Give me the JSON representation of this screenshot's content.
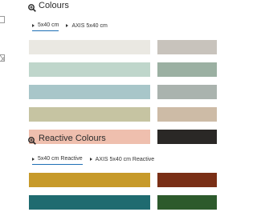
{
  "colours_section": {
    "title": "Colours",
    "tabs": [
      {
        "label": "5x40 cm",
        "active": true
      },
      {
        "label": "AXIS 5x40 cm",
        "active": false
      }
    ],
    "swatches": [
      {
        "color": "#eae8e2"
      },
      {
        "color": "#c8c3bc"
      },
      {
        "color": "#bfd6cb"
      },
      {
        "color": "#9bb0a2"
      },
      {
        "color": "#a8c6c9"
      },
      {
        "color": "#aab3ae"
      },
      {
        "color": "#c6c4a2"
      },
      {
        "color": "#cdbba6"
      },
      {
        "color": "#efbfae"
      },
      {
        "color": "#2a2826"
      }
    ]
  },
  "reactive_section": {
    "title": "Reactive Colours",
    "tabs": [
      {
        "label": "5x40 cm Reactive",
        "active": true
      },
      {
        "label": "AXIS 5x40 cm Reactive",
        "active": false
      }
    ],
    "swatches": [
      {
        "color": "#c79a2a"
      },
      {
        "color": "#7a2f16"
      },
      {
        "color": "#1f6b70"
      },
      {
        "color": "#2d5a2c"
      }
    ]
  }
}
